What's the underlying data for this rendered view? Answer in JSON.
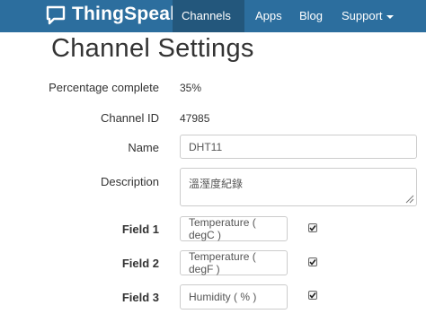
{
  "navbar": {
    "brand": "ThingSpeak",
    "items": [
      {
        "label": "Channels",
        "active": true,
        "dropdown": true
      },
      {
        "label": "Apps",
        "active": false,
        "dropdown": false
      },
      {
        "label": "Blog",
        "active": false,
        "dropdown": false
      },
      {
        "label": "Support",
        "active": false,
        "dropdown": true
      }
    ],
    "colors": {
      "bar": "#2c6e9e",
      "active": "#23577c"
    }
  },
  "page": {
    "title": "Channel Settings"
  },
  "form": {
    "percentage_label": "Percentage complete",
    "percentage_value": "35%",
    "channel_id_label": "Channel ID",
    "channel_id_value": "47985",
    "name_label": "Name",
    "name_value": "DHT11",
    "description_label": "Description",
    "description_value": "溫溼度紀錄",
    "fields": [
      {
        "label": "Field 1",
        "value": "Temperature ( degC )",
        "checked": true
      },
      {
        "label": "Field 2",
        "value": "Temperature ( degF )",
        "checked": true
      },
      {
        "label": "Field 3",
        "value": "Humidity ( % )",
        "checked": true
      }
    ]
  }
}
